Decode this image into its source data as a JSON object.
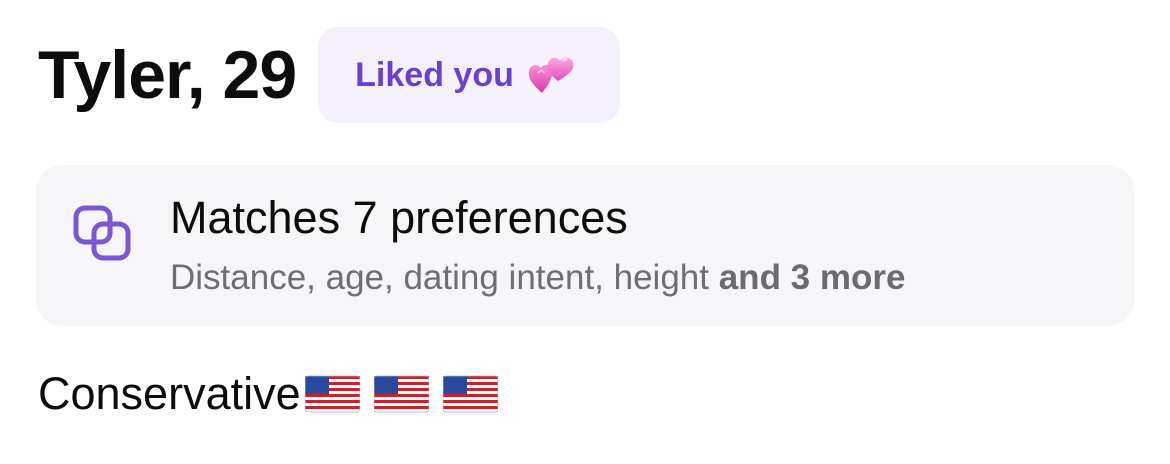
{
  "profile": {
    "name_age": "Tyler, 29",
    "badge": {
      "label": "Liked you",
      "icon": "heart-with-ribbon-icon",
      "background_color": "#f4f0fc",
      "text_color": "#6b3fd0"
    }
  },
  "preferences_card": {
    "icon": "overlapping-squares-icon",
    "icon_color": "#7b57d6",
    "title": "Matches 7 preferences",
    "subtitle": "Distance, age, dating intent, height",
    "subtitle_more": "and 3 more",
    "background_color": "#f6f6f8"
  },
  "bio": {
    "text": "Conservative",
    "emojis": [
      "us-flag-icon",
      "us-flag-icon",
      "us-flag-icon"
    ]
  }
}
